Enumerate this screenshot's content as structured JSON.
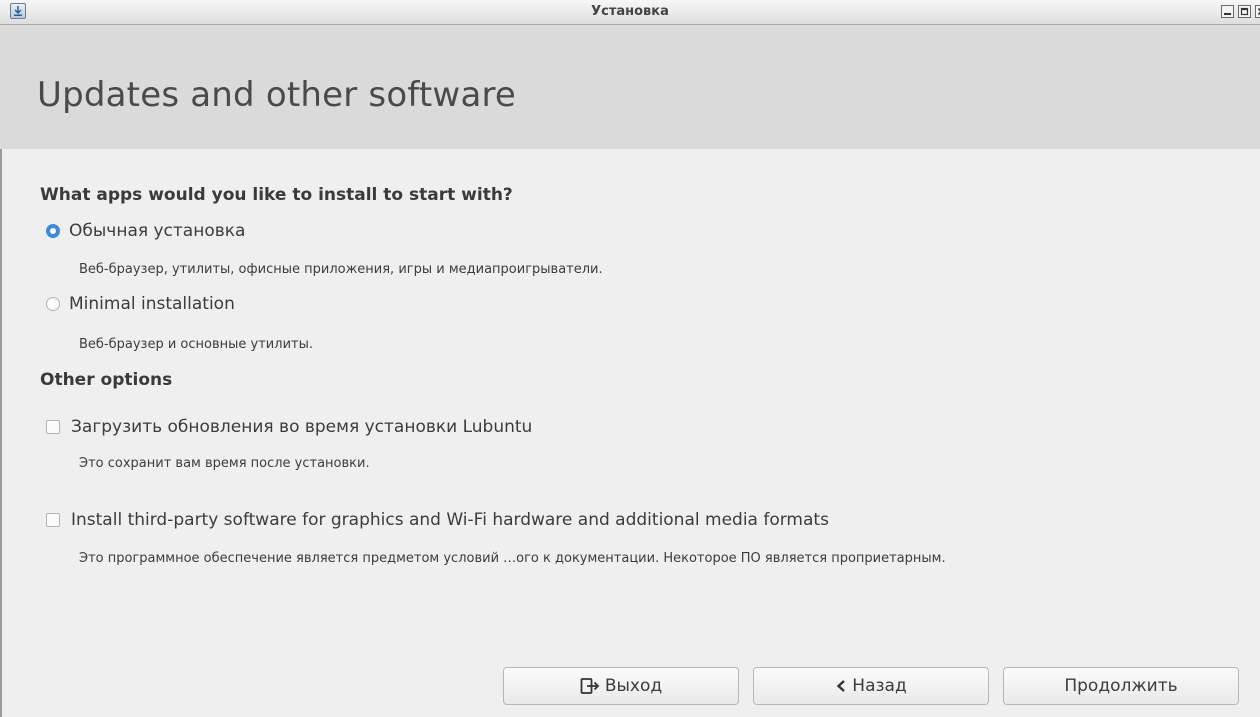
{
  "window": {
    "title": "Установка",
    "icon": "installer-icon",
    "controls": [
      "minimize-icon",
      "maximize-icon",
      "close-icon"
    ]
  },
  "header": {
    "title": "Updates and other software"
  },
  "apps_section": {
    "heading": "What apps would you like to install to start with?",
    "options": [
      {
        "label": "Обычная установка",
        "description": "Веб-браузер, утилиты, офисные приложения, игры и медиапроигрыватели.",
        "selected": true
      },
      {
        "label": "Minimal installation",
        "description": "Веб-браузер и основные утилиты.",
        "selected": false
      }
    ]
  },
  "other_section": {
    "heading": "Other options",
    "options": [
      {
        "label": "Загрузить обновления во время установки Lubuntu",
        "description": "Это сохранит вам время после установки.",
        "checked": false
      },
      {
        "label": "Install third-party software for graphics and Wi-Fi hardware and additional media formats",
        "description": "Это программное обеспечение является предметом условий …ого к документации. Некоторое ПО является проприетарным.",
        "checked": false
      }
    ]
  },
  "buttons": {
    "quit": {
      "label": "Выход",
      "icon": "exit-icon"
    },
    "back": {
      "label": "Назад",
      "icon": "chevron-left-icon"
    },
    "continue": {
      "label": "Продолжить"
    }
  },
  "colors": {
    "accent": "#3f8ad6",
    "header_bg": "#dadada",
    "body_bg": "#efefef"
  }
}
